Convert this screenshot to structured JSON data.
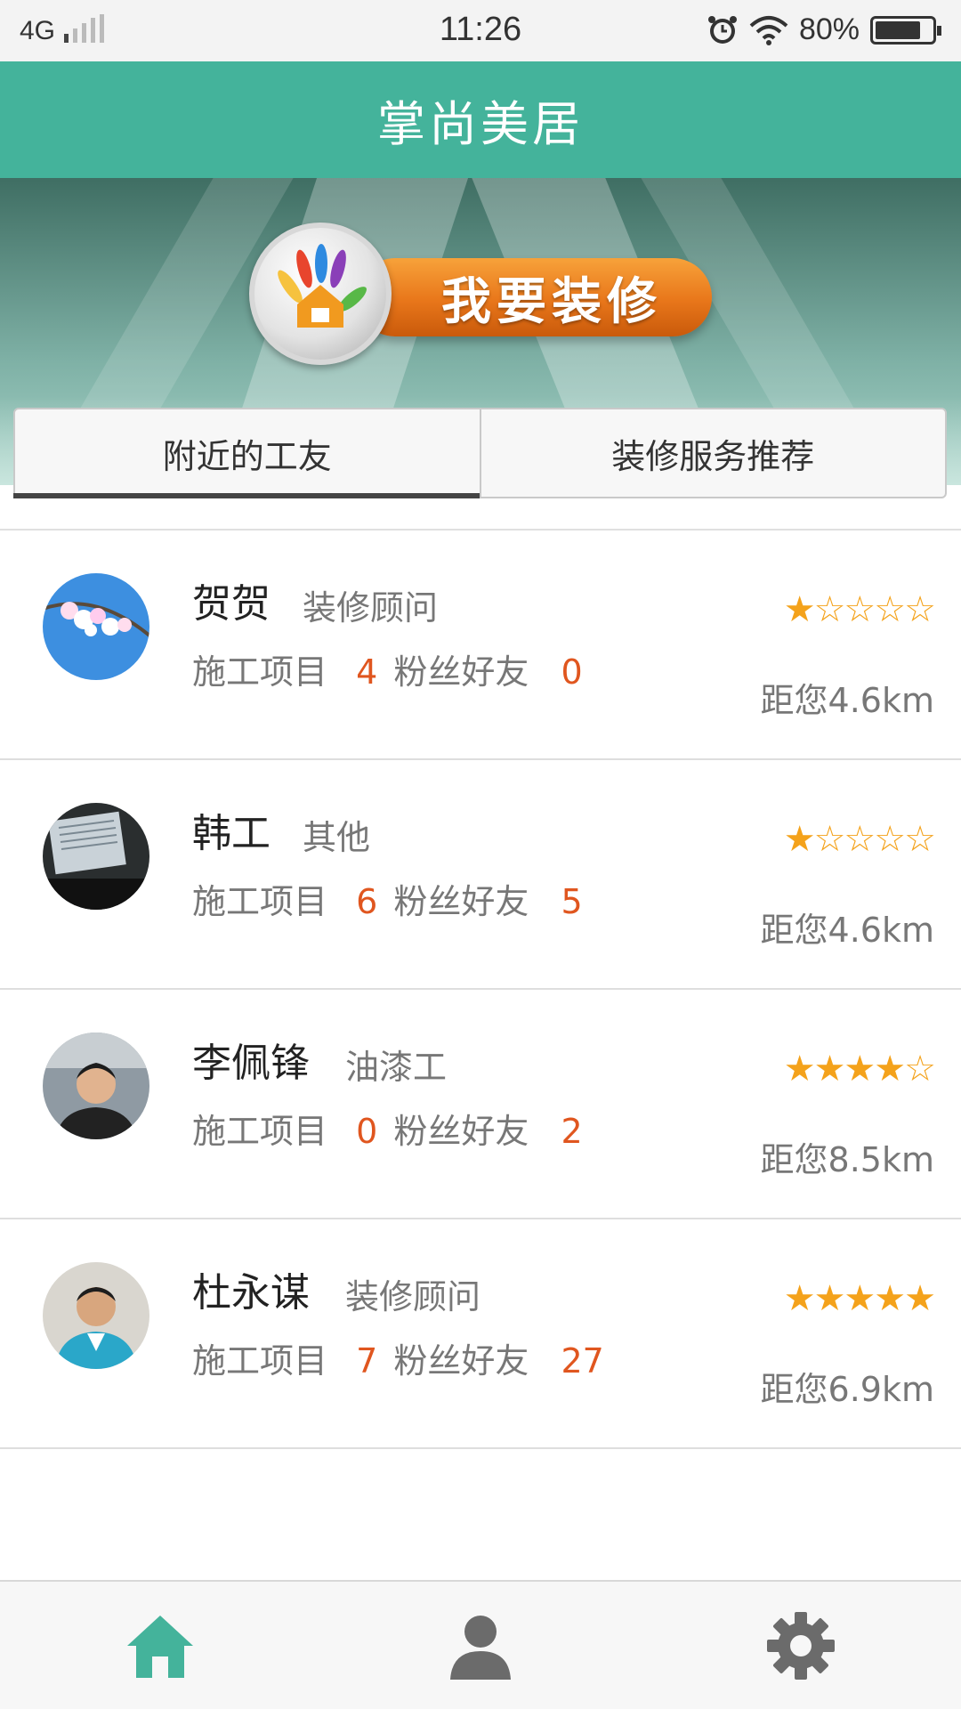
{
  "status_bar": {
    "network": "4G",
    "time": "11:26",
    "battery_text": "80%",
    "battery_level": 0.8
  },
  "header": {
    "title": "掌尚美居"
  },
  "banner": {
    "button_label": "我要装修"
  },
  "tabs": [
    {
      "label": "附近的工友",
      "active": true
    },
    {
      "label": "装修服务推荐",
      "active": false
    }
  ],
  "stat_labels": {
    "projects": "施工项目",
    "fans": "粉丝好友"
  },
  "workers": [
    {
      "name": "贺贺",
      "role": "装修顾问",
      "projects": "4",
      "fans": "0",
      "rating": 1,
      "stars": "★☆☆☆☆",
      "distance": "距您4.6km"
    },
    {
      "name": "韩工",
      "role": "其他",
      "projects": "6",
      "fans": "5",
      "rating": 1,
      "stars": "★☆☆☆☆",
      "distance": "距您4.6km"
    },
    {
      "name": "李佩锋",
      "role": "油漆工",
      "projects": "0",
      "fans": "2",
      "rating": 4,
      "stars": "★★★★☆",
      "distance": "距您8.5km"
    },
    {
      "name": "杜永谋",
      "role": "装修顾问",
      "projects": "7",
      "fans": "27",
      "rating": 5,
      "stars": "★★★★★",
      "distance": "距您6.9km"
    }
  ],
  "bottom_nav": [
    {
      "icon": "home-icon",
      "active": true
    },
    {
      "icon": "user-icon",
      "active": false
    },
    {
      "icon": "gear-icon",
      "active": false
    }
  ],
  "colors": {
    "brand": "#44b39b",
    "accent_orange": "#e0561f",
    "star": "#f4a21b"
  }
}
